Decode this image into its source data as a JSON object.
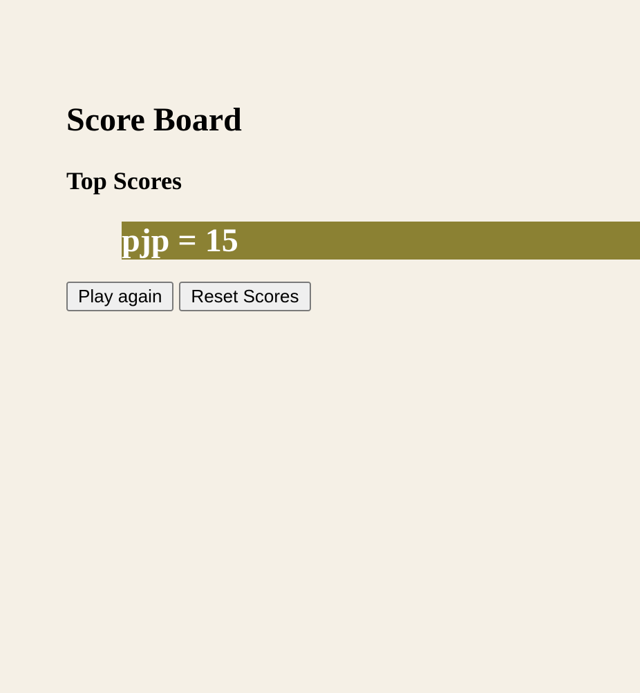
{
  "page": {
    "title": "Score Board",
    "subtitle": "Top Scores"
  },
  "scores": [
    {
      "text": "pjp = 15"
    }
  ],
  "actions": {
    "play_again_label": "Play again",
    "reset_scores_label": "Reset Scores"
  },
  "colors": {
    "background": "#f5f0e6",
    "score_row_bg": "#8b8133",
    "score_row_text": "#ffffff"
  }
}
